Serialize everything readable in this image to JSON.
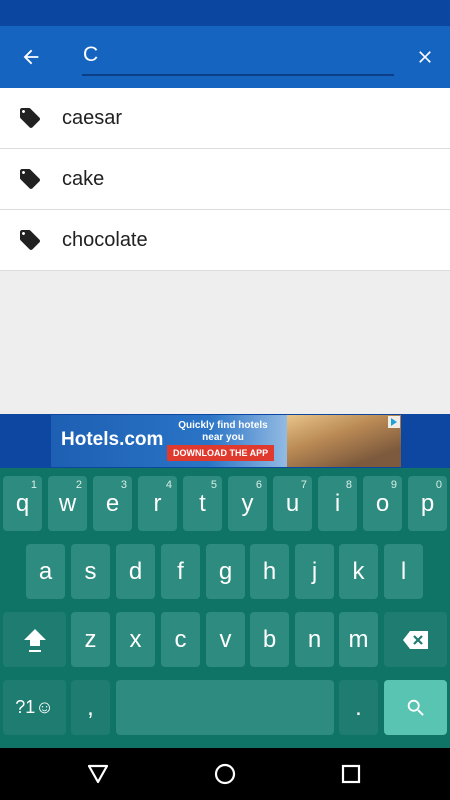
{
  "search": {
    "value": "C",
    "placeholder": ""
  },
  "suggestions": [
    {
      "label": "caesar",
      "icon": "tag-icon"
    },
    {
      "label": "cake",
      "icon": "tag-icon"
    },
    {
      "label": "chocolate",
      "icon": "tag-icon"
    }
  ],
  "ad": {
    "brand": "Hotels.com",
    "tagline": "Quickly find hotels near you",
    "cta": "DOWNLOAD THE APP"
  },
  "keyboard": {
    "row1": [
      {
        "key": "q",
        "hint": "1"
      },
      {
        "key": "w",
        "hint": "2"
      },
      {
        "key": "e",
        "hint": "3"
      },
      {
        "key": "r",
        "hint": "4"
      },
      {
        "key": "t",
        "hint": "5"
      },
      {
        "key": "y",
        "hint": "6"
      },
      {
        "key": "u",
        "hint": "7"
      },
      {
        "key": "i",
        "hint": "8"
      },
      {
        "key": "o",
        "hint": "9"
      },
      {
        "key": "p",
        "hint": "0"
      }
    ],
    "row2": [
      "a",
      "s",
      "d",
      "f",
      "g",
      "h",
      "j",
      "k",
      "l"
    ],
    "row3": [
      "z",
      "x",
      "c",
      "v",
      "b",
      "n",
      "m"
    ],
    "symbols_label": "?1☺",
    "comma": ",",
    "period": "."
  },
  "colors": {
    "app_bar": "#1565c0",
    "status_bar": "#0b47a1",
    "keyboard_bg": "#0f7466",
    "key": "#2e8b7f",
    "search_key": "#5ac4b3"
  }
}
